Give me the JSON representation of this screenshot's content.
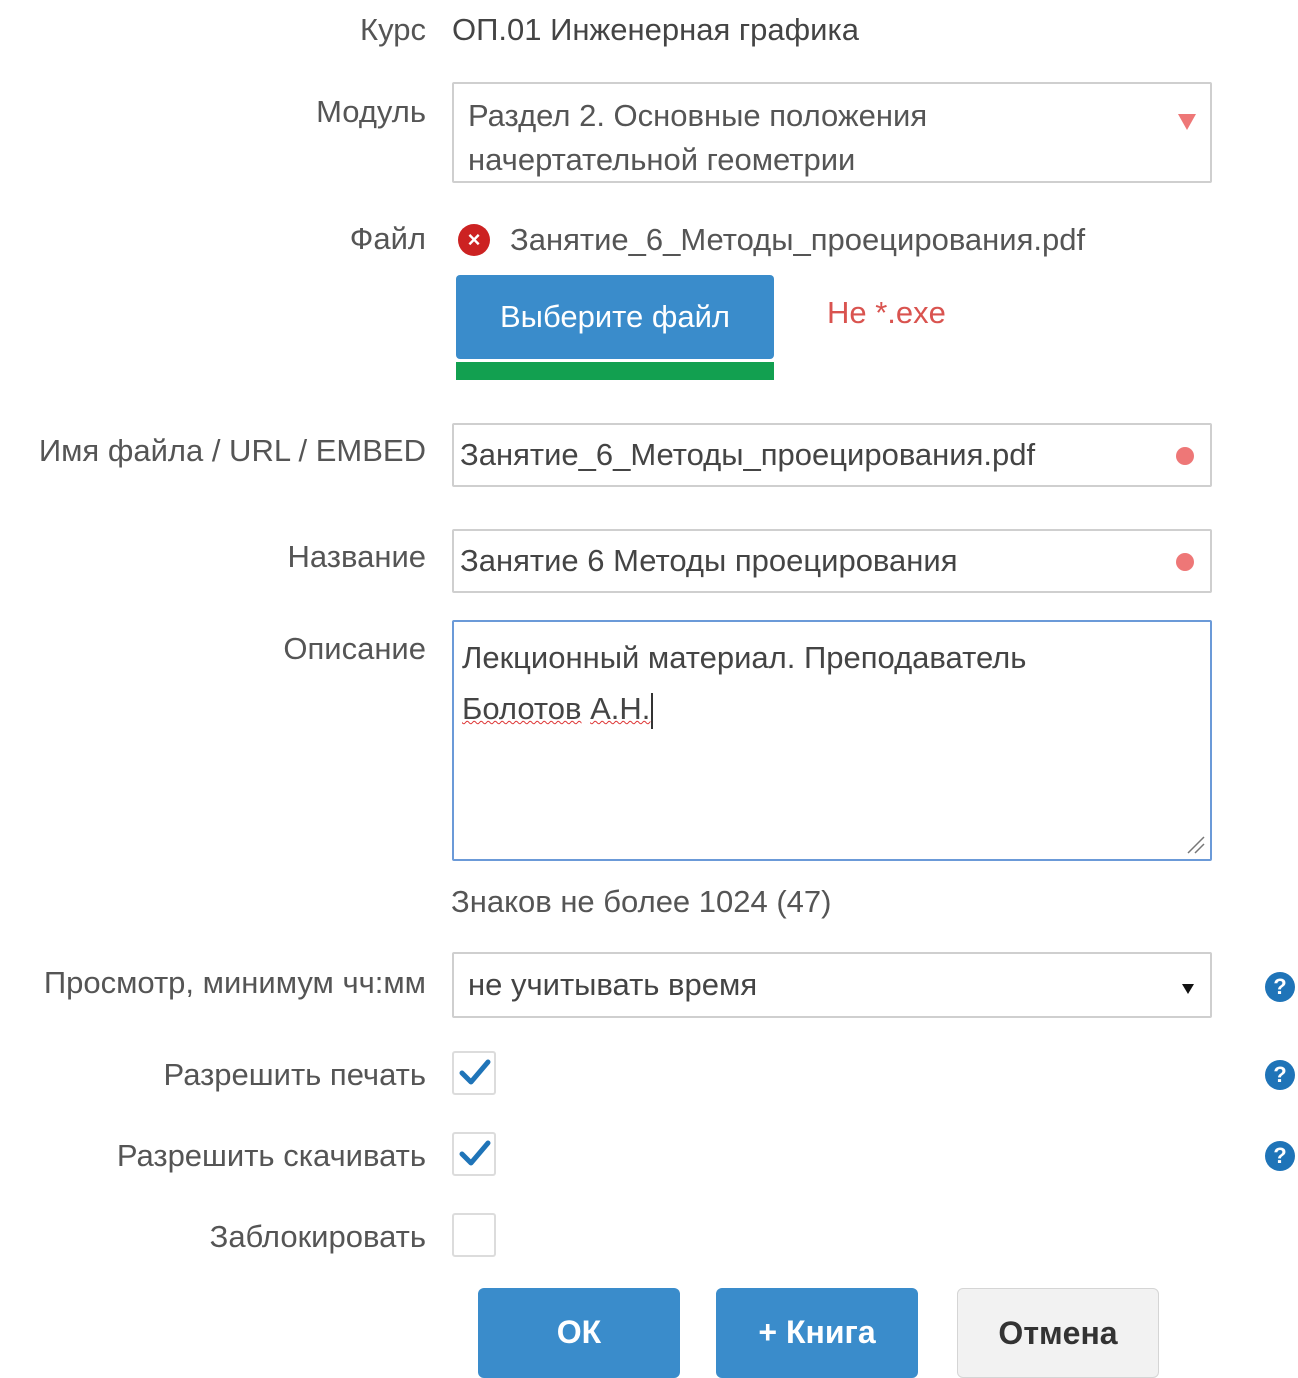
{
  "form": {
    "course": {
      "label": "Курс",
      "value": "ОП.01 Инженерная графика"
    },
    "module": {
      "label": "Модуль",
      "line1": "Раздел 2. Основные положения",
      "line2": "начертательной геометрии"
    },
    "file": {
      "label": "Файл",
      "selected_name": "Занятие_6_Методы_проецирования.pdf",
      "choose_label": "Выберите файл",
      "restriction": "Не *.exe",
      "upload_progress": 1.0
    },
    "filename": {
      "label": "Имя файла / URL / EMBED",
      "value": "Занятие_6_Методы_проецирования.pdf"
    },
    "title": {
      "label": "Название",
      "value": "Занятие 6 Методы проецирования"
    },
    "description": {
      "label": "Описание",
      "line1": "Лекционный материал. Преподаватель",
      "word_a": "Болотов",
      "word_b": "А.Н.",
      "counter": "Знаков не более  1024 (47)"
    },
    "view_time": {
      "label": "Просмотр, минимум чч:мм",
      "value": "не учитывать время"
    },
    "allow_print": {
      "label": "Разрешить печать",
      "checked": true
    },
    "allow_download": {
      "label": "Разрешить скачивать",
      "checked": true
    },
    "block": {
      "label": "Заблокировать",
      "checked": false
    }
  },
  "help_icon": "?",
  "error_icon": "×",
  "buttons": {
    "ok": "ОК",
    "add_book": "+ Книга",
    "cancel": "Отмена"
  },
  "colors": {
    "primary": "#3a8ccb",
    "progress": "#12a050",
    "required_dot": "#ee7777",
    "warning_text": "#d9534f",
    "help": "#1f74b8",
    "error": "#cc2222"
  }
}
